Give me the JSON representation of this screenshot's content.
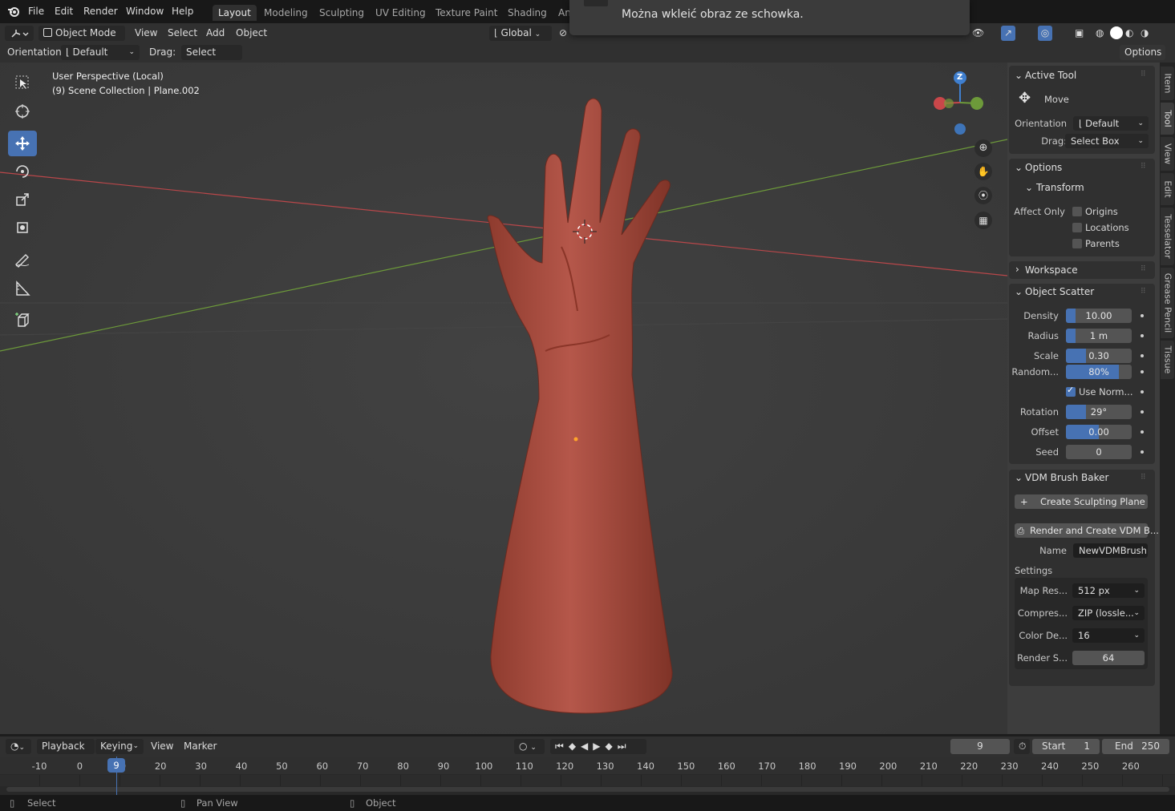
{
  "topbar": {
    "menus": [
      "File",
      "Edit",
      "Render",
      "Window",
      "Help"
    ],
    "workspaces": [
      "Layout",
      "Modeling",
      "Sculpting",
      "UV Editing",
      "Texture Paint",
      "Shading",
      "An"
    ],
    "active_workspace": "Layout"
  },
  "notification": {
    "text": "Można wkleić obraz ze schowka."
  },
  "header": {
    "mode": "Object Mode",
    "menus": [
      "View",
      "Select",
      "Add",
      "Object"
    ],
    "transform_orientation": "Global",
    "orientation_label": "Orientation:",
    "orientation_value": "Default",
    "drag_label": "Drag:",
    "drag_value": "Select Box",
    "options_label": "Options"
  },
  "viewport": {
    "perspective": "User Perspective (Local)",
    "collection": "(9) Scene Collection | Plane.002",
    "gizmo_axis_z": "Z"
  },
  "npanel": {
    "active_tool": {
      "title": "Active Tool",
      "tool_name": "Move",
      "orientation_label": "Orientation",
      "orientation_value": "Default",
      "drag_label": "Drag:",
      "drag_value": "Select Box"
    },
    "options": {
      "title": "Options",
      "transform_title": "Transform",
      "affect_only_label": "Affect Only",
      "checkboxes": [
        "Origins",
        "Locations",
        "Parents"
      ]
    },
    "workspace": {
      "title": "Workspace"
    },
    "object_scatter": {
      "title": "Object Scatter",
      "density_label": "Density",
      "density_value": "10.00",
      "density_fill": 0.15,
      "radius_label": "Radius",
      "radius_value": "1 m",
      "radius_fill": 0.15,
      "scale_label": "Scale",
      "scale_value": "0.30",
      "scale_fill": 0.3,
      "random_label": "Random...",
      "random_value": "80%",
      "random_fill": 0.8,
      "use_normal_label": "Use Norm...",
      "rotation_label": "Rotation",
      "rotation_value": "29°",
      "rotation_fill": 0.3,
      "offset_label": "Offset",
      "offset_value": "0.00",
      "offset_fill": 0.5,
      "seed_label": "Seed",
      "seed_value": "0"
    },
    "vdm": {
      "title": "VDM Brush Baker",
      "create_plane_label": "Create Sculpting Plane",
      "render_label": "Render and Create VDM B...",
      "name_label": "Name",
      "name_value": "NewVDMBrush",
      "settings_label": "Settings",
      "map_res_label": "Map Res...",
      "map_res_value": "512 px",
      "compress_label": "Compres...",
      "compress_value": "ZIP (lossle...",
      "color_depth_label": "Color De...",
      "color_depth_value": "16",
      "render_samples_label": "Render S...",
      "render_samples_value": "64"
    }
  },
  "right_tabs": [
    "Item",
    "Tool",
    "View",
    "Edit",
    "Tesselator",
    "Grease Pencil",
    "Tissue"
  ],
  "timeline": {
    "menus": [
      "Playback",
      "Keying",
      "View",
      "Marker"
    ],
    "current_frame": "9",
    "start_label": "Start",
    "start_value": "1",
    "end_label": "End",
    "end_value": "250",
    "ticks": [
      "-10",
      "0",
      "10",
      "20",
      "30",
      "40",
      "50",
      "60",
      "70",
      "80",
      "90",
      "100",
      "110",
      "120",
      "130",
      "140",
      "150",
      "160",
      "170",
      "180",
      "190",
      "200",
      "210",
      "220",
      "230",
      "240",
      "250",
      "260"
    ]
  },
  "status": {
    "select": "Select",
    "pan": "Pan View",
    "object": "Object"
  },
  "colors": {
    "accent": "#4772b3",
    "skin": "#a5493b",
    "x_axis": "#c94a4a",
    "y_axis": "#6d9a3a"
  }
}
